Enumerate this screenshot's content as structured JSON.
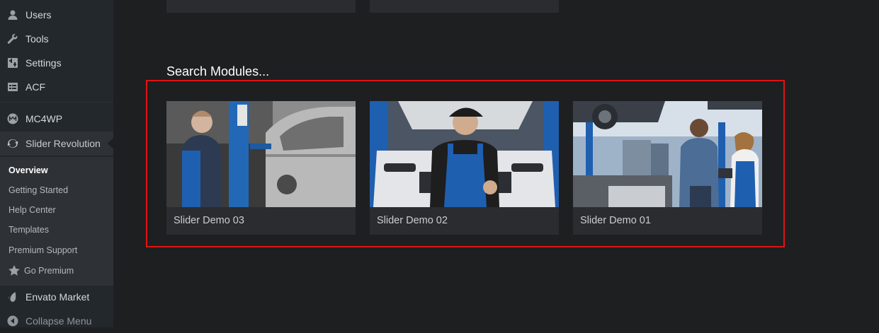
{
  "sidebar": {
    "items": [
      {
        "label": "Users",
        "icon": "user-icon"
      },
      {
        "label": "Tools",
        "icon": "wrench-icon"
      },
      {
        "label": "Settings",
        "icon": "settings-icon"
      },
      {
        "label": "ACF",
        "icon": "table-icon"
      },
      {
        "label": "MC4WP",
        "icon": "mc4wp-icon"
      },
      {
        "label": "Slider Revolution",
        "icon": "refresh-icon"
      }
    ],
    "submenu": [
      {
        "label": "Overview"
      },
      {
        "label": "Getting Started"
      },
      {
        "label": "Help Center"
      },
      {
        "label": "Templates"
      },
      {
        "label": "Premium Support"
      },
      {
        "label": "Go Premium",
        "icon": "star-icon"
      }
    ],
    "footer": [
      {
        "label": "Envato Market",
        "icon": "envato-icon"
      },
      {
        "label": "Collapse Menu",
        "icon": "collapse-icon"
      }
    ]
  },
  "main": {
    "section_title": "Search Modules...",
    "modules": [
      {
        "title": "Slider Demo 03",
        "image": "mechanic-with-car-grayscale"
      },
      {
        "title": "Slider Demo 02",
        "image": "smiling-mechanic-white-car"
      },
      {
        "title": "Slider Demo 01",
        "image": "mechanics-in-workshop"
      }
    ]
  },
  "colors": {
    "background": "#1e1f21",
    "sidebar": "#23282d",
    "card": "#2a2c30",
    "highlight_border": "#e01313",
    "accent_blue": "#1f5fb0"
  }
}
